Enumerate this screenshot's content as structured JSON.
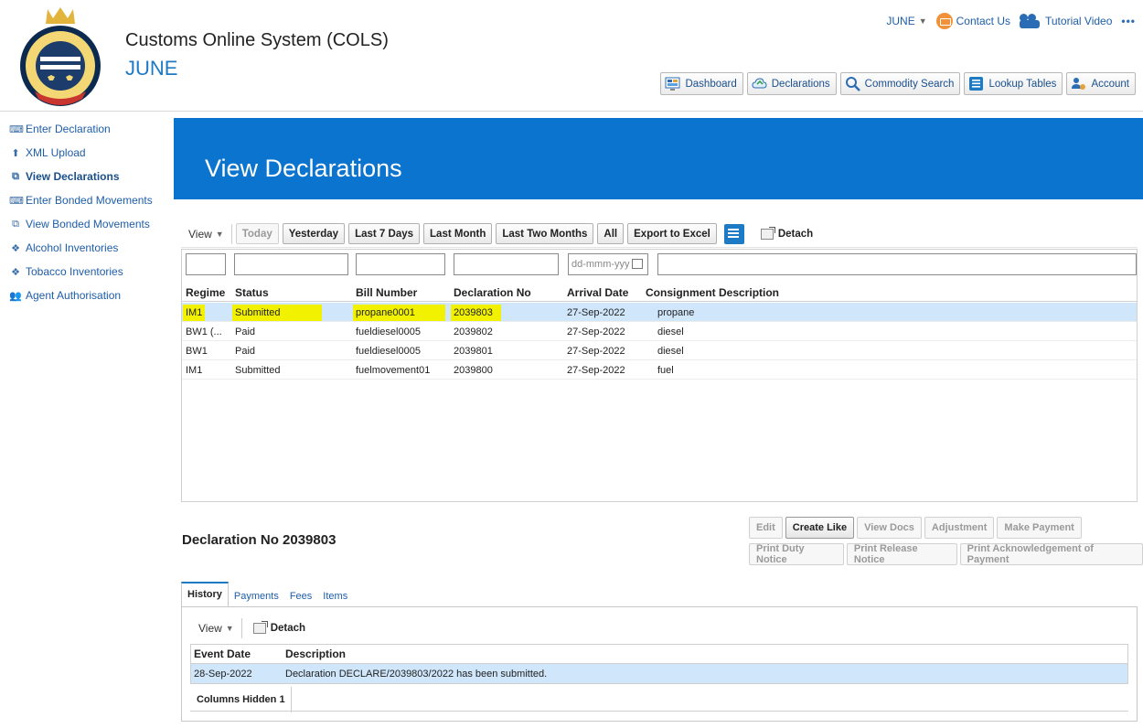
{
  "header": {
    "app_title": "Customs Online System (COLS)",
    "user": "JUNE",
    "user_menu": "JUNE",
    "contact_us": "Contact Us",
    "tutorial_video": "Tutorial Video",
    "more": "•••"
  },
  "nav": {
    "dashboard": "Dashboard",
    "declarations": "Declarations",
    "commodity_search": "Commodity Search",
    "lookup_tables": "Lookup Tables",
    "account": "Account"
  },
  "sidebar": {
    "items": [
      {
        "label": "Enter Declaration",
        "icon": "⌨"
      },
      {
        "label": "XML Upload",
        "icon": "⬆"
      },
      {
        "label": "View Declarations",
        "icon": "⧉"
      },
      {
        "label": "Enter Bonded Movements",
        "icon": "⌨"
      },
      {
        "label": "View Bonded Movements",
        "icon": "⧉"
      },
      {
        "label": "Alcohol Inventories",
        "icon": "❖"
      },
      {
        "label": "Tobacco Inventories",
        "icon": "❖"
      },
      {
        "label": "Agent Authorisation",
        "icon": "👥"
      }
    ]
  },
  "page": {
    "title": "View Declarations"
  },
  "toolbar": {
    "view": "View",
    "today": "Today",
    "yesterday": "Yesterday",
    "last7": "Last 7 Days",
    "last_month": "Last Month",
    "last_two_months": "Last Two Months",
    "all": "All",
    "export": "Export to Excel",
    "detach": "Detach"
  },
  "filters": {
    "date_placeholder": "dd-mmm-yyy"
  },
  "table": {
    "columns": [
      "Regime",
      "Status",
      "Bill Number",
      "Declaration No",
      "Arrival Date",
      "Consignment Description"
    ],
    "rows": [
      [
        "IM1",
        "Submitted",
        "propane0001",
        "2039803",
        "27-Sep-2022",
        "propane"
      ],
      [
        "BW1 (...",
        "Paid",
        "fueldiesel0005",
        "2039802",
        "27-Sep-2022",
        "diesel"
      ],
      [
        "BW1",
        "Paid",
        "fueldiesel0005",
        "2039801",
        "27-Sep-2022",
        "diesel"
      ],
      [
        "IM1",
        "Submitted",
        "fuelmovement01",
        "2039800",
        "27-Sep-2022",
        "fuel"
      ]
    ]
  },
  "detail": {
    "title": "Declaration No 2039803",
    "actions_row1": [
      "Edit",
      "Create Like",
      "View Docs",
      "Adjustment",
      "Make Payment"
    ],
    "actions_row2": [
      "Print Duty Notice",
      "Print Release Notice",
      "Print Acknowledgement of Payment"
    ],
    "tabs": [
      "History",
      "Payments",
      "Fees",
      "Items"
    ],
    "history": {
      "view": "View",
      "detach": "Detach",
      "columns": [
        "Event Date",
        "Description"
      ],
      "rows": [
        [
          "28-Sep-2022",
          "Declaration DECLARE/2039803/2022 has been submitted."
        ]
      ],
      "columns_hidden_label": "Columns Hidden",
      "columns_hidden_count": "1"
    }
  },
  "colors": {
    "banner": "#0a74cf",
    "selected_row": "#cfe6fb",
    "highlight": "#f2f200",
    "link": "#1d5da8"
  }
}
